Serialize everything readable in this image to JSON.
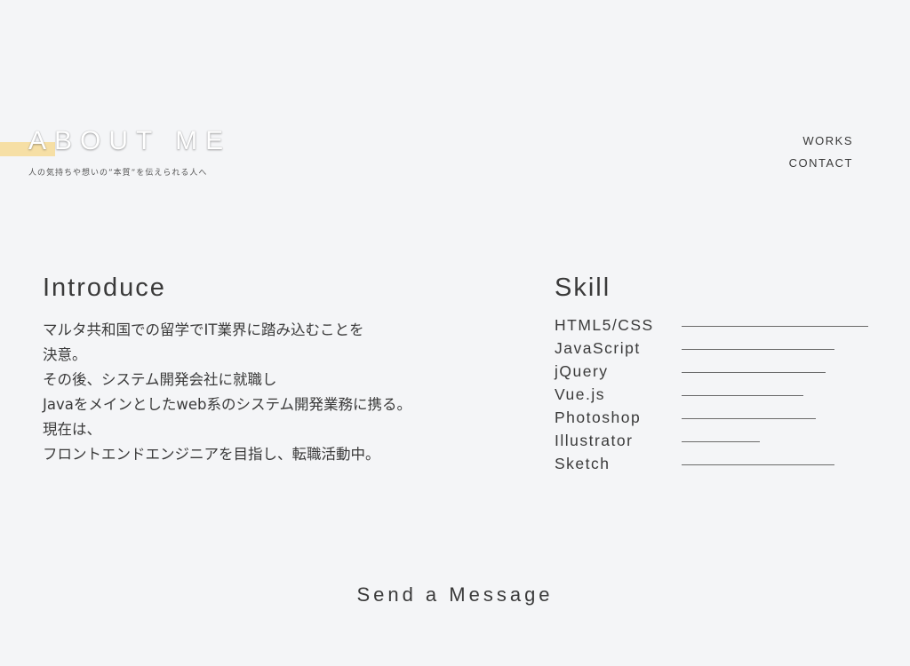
{
  "hero": {
    "title": "ABOUT ME",
    "subtitle": "人の気持ちや想いの”本質”を伝えられる人へ",
    "accent_color": "#f6dfa5"
  },
  "nav": {
    "items": [
      {
        "label": "WORKS"
      },
      {
        "label": "CONTACT"
      }
    ]
  },
  "introduce": {
    "heading": "Introduce",
    "lines": [
      "マルタ共和国での留学でIT業界に踏み込むことを",
      "決意。",
      "その後、システム開発会社に就職し",
      "Javaをメインとしたweb系のシステム開発業務に携る。",
      "現在は、",
      "フロントエンドエンジニアを目指し、転職活動中。"
    ]
  },
  "skill": {
    "heading": "Skill",
    "items": [
      {
        "name": "HTML5/CSS",
        "level": 1.0
      },
      {
        "name": "JavaScript",
        "level": 0.82
      },
      {
        "name": "jQuery",
        "level": 0.77
      },
      {
        "name": "Vue.js",
        "level": 0.65
      },
      {
        "name": "Photoshop",
        "level": 0.72
      },
      {
        "name": "Illustrator",
        "level": 0.42
      },
      {
        "name": "Sketch",
        "level": 0.82
      }
    ]
  },
  "footer": {
    "send_message": "Send a Message"
  }
}
